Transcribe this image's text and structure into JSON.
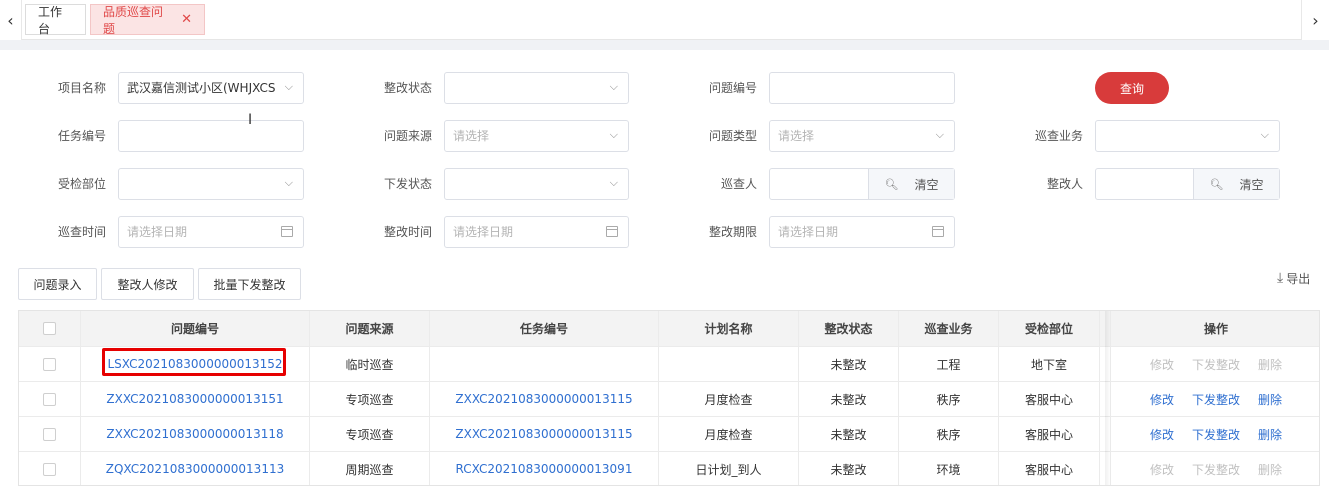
{
  "tabs": [
    {
      "label": "工作台"
    },
    {
      "label": "品质巡查问题",
      "close": "✕"
    }
  ],
  "filters": {
    "project_name": {
      "label": "项目名称",
      "value": "武汉嘉信测试小区(WHJXCS"
    },
    "rect_status": {
      "label": "整改状态",
      "value": ""
    },
    "issue_no": {
      "label": "问题编号",
      "value": ""
    },
    "task_no": {
      "label": "任务编号",
      "value": ""
    },
    "issue_source": {
      "label": "问题来源",
      "placeholder": "请选择"
    },
    "issue_type": {
      "label": "问题类型",
      "placeholder": "请选择"
    },
    "patrol_business": {
      "label": "巡查业务",
      "value": ""
    },
    "inspected_dept": {
      "label": "受检部位",
      "value": ""
    },
    "dispatch_status": {
      "label": "下发状态",
      "value": ""
    },
    "inspector": {
      "label": "巡查人",
      "clear": "清空"
    },
    "rectifier": {
      "label": "整改人",
      "clear": "清空"
    },
    "patrol_time": {
      "label": "巡查时间",
      "placeholder": "请选择日期"
    },
    "rect_time": {
      "label": "整改时间",
      "placeholder": "请选择日期"
    },
    "rect_deadline": {
      "label": "整改期限",
      "placeholder": "请选择日期"
    }
  },
  "query_label": "查询",
  "actions": {
    "entry": "问题录入",
    "modify_rectifier": "整改人修改",
    "batch_dispatch": "批量下发整改",
    "export": "导出"
  },
  "table": {
    "headers": [
      "问题编号",
      "问题来源",
      "任务编号",
      "计划名称",
      "整改状态",
      "巡查业务",
      "受检部位",
      "操作"
    ],
    "op_labels": {
      "edit": "修改",
      "dispatch": "下发整改",
      "delete": "删除"
    },
    "rows": [
      {
        "issue_no": "LSXC2021083000000013152",
        "source": "临时巡查",
        "task_no": "",
        "plan": "",
        "status": "未整改",
        "business": "工程",
        "dept": "地下室",
        "ops_enabled": false
      },
      {
        "issue_no": "ZXXC2021083000000013151",
        "source": "专项巡查",
        "task_no": "ZXXC2021083000000013115",
        "plan": "月度检查",
        "status": "未整改",
        "business": "秩序",
        "dept": "客服中心",
        "ops_enabled": true
      },
      {
        "issue_no": "ZXXC2021083000000013118",
        "source": "专项巡查",
        "task_no": "ZXXC2021083000000013115",
        "plan": "月度检查",
        "status": "未整改",
        "business": "秩序",
        "dept": "客服中心",
        "ops_enabled": true
      },
      {
        "issue_no": "ZQXC2021083000000013113",
        "source": "周期巡查",
        "task_no": "RCXC2021083000000013091",
        "plan": "日计划_到人",
        "status": "未整改",
        "business": "环境",
        "dept": "客服中心",
        "ops_enabled": false
      }
    ]
  },
  "colors": {
    "accent": "#d83b3b",
    "link": "#2f6fd0",
    "highlight": "#e60000"
  }
}
